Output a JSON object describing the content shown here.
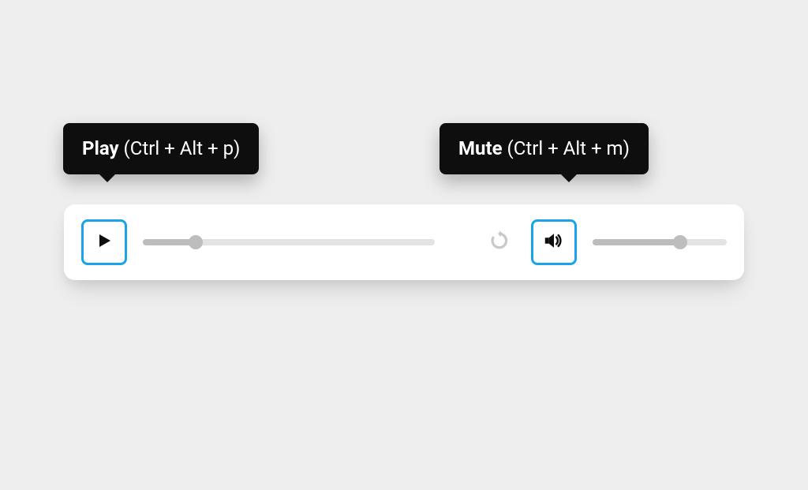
{
  "tooltips": {
    "play": {
      "label": "Play",
      "shortcut": "(Ctrl + Alt + p)"
    },
    "mute": {
      "label": "Mute",
      "shortcut": "(Ctrl + Alt + m)"
    }
  },
  "controls": {
    "play_focused": true,
    "mute_focused": true,
    "progress_pct": 18,
    "volume_pct": 65
  },
  "colors": {
    "accent": "#1aa3e8",
    "tooltip_bg": "#0e0e0f",
    "bar_bg": "#ffffff",
    "page_bg": "#eeeeee",
    "slider_track": "#e3e3e3",
    "slider_fill": "#bdbdbd"
  }
}
